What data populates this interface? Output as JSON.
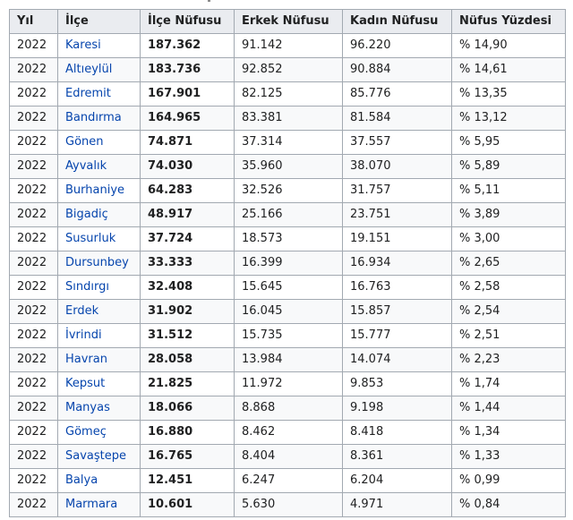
{
  "table": {
    "headers": [
      "Yıl",
      "İlçe",
      "İlçe Nüfusu",
      "Erkek Nüfusu",
      "Kadın Nüfusu",
      "Nüfus Yüzdesi"
    ],
    "rows": [
      {
        "year": "2022",
        "district": "Karesi",
        "population": "187.362",
        "male": "91.142",
        "female": "96.220",
        "share": "% 14,90"
      },
      {
        "year": "2022",
        "district": "Altıeylül",
        "population": "183.736",
        "male": "92.852",
        "female": "90.884",
        "share": "% 14,61"
      },
      {
        "year": "2022",
        "district": "Edremit",
        "population": "167.901",
        "male": "82.125",
        "female": "85.776",
        "share": "% 13,35"
      },
      {
        "year": "2022",
        "district": "Bandırma",
        "population": "164.965",
        "male": "83.381",
        "female": "81.584",
        "share": "% 13,12"
      },
      {
        "year": "2022",
        "district": "Gönen",
        "population": "74.871",
        "male": "37.314",
        "female": "37.557",
        "share": "% 5,95"
      },
      {
        "year": "2022",
        "district": "Ayvalık",
        "population": "74.030",
        "male": "35.960",
        "female": "38.070",
        "share": "% 5,89"
      },
      {
        "year": "2022",
        "district": "Burhaniye",
        "population": "64.283",
        "male": "32.526",
        "female": "31.757",
        "share": "% 5,11"
      },
      {
        "year": "2022",
        "district": "Bigadiç",
        "population": "48.917",
        "male": "25.166",
        "female": "23.751",
        "share": "% 3,89"
      },
      {
        "year": "2022",
        "district": "Susurluk",
        "population": "37.724",
        "male": "18.573",
        "female": "19.151",
        "share": "% 3,00"
      },
      {
        "year": "2022",
        "district": "Dursunbey",
        "population": "33.333",
        "male": "16.399",
        "female": "16.934",
        "share": "% 2,65"
      },
      {
        "year": "2022",
        "district": "Sındırgı",
        "population": "32.408",
        "male": "15.645",
        "female": "16.763",
        "share": "% 2,58"
      },
      {
        "year": "2022",
        "district": "Erdek",
        "population": "31.902",
        "male": "16.045",
        "female": "15.857",
        "share": "% 2,54"
      },
      {
        "year": "2022",
        "district": "İvrindi",
        "population": "31.512",
        "male": "15.735",
        "female": "15.777",
        "share": "% 2,51"
      },
      {
        "year": "2022",
        "district": "Havran",
        "population": "28.058",
        "male": "13.984",
        "female": "14.074",
        "share": "% 2,23"
      },
      {
        "year": "2022",
        "district": "Kepsut",
        "population": "21.825",
        "male": "11.972",
        "female": "9.853",
        "share": "% 1,74"
      },
      {
        "year": "2022",
        "district": "Manyas",
        "population": "18.066",
        "male": "8.868",
        "female": "9.198",
        "share": "% 1,44"
      },
      {
        "year": "2022",
        "district": "Gömeç",
        "population": "16.880",
        "male": "8.462",
        "female": "8.418",
        "share": "% 1,34"
      },
      {
        "year": "2022",
        "district": "Savaştepe",
        "population": "16.765",
        "male": "8.404",
        "female": "8.361",
        "share": "% 1,33"
      },
      {
        "year": "2022",
        "district": "Balya",
        "population": "12.451",
        "male": "6.247",
        "female": "6.204",
        "share": "% 0,99"
      },
      {
        "year": "2022",
        "district": "Marmara",
        "population": "10.601",
        "male": "5.630",
        "female": "4.971",
        "share": "% 0,84"
      }
    ]
  },
  "colors": {
    "link": "#0645ad",
    "border": "#a2a9b1",
    "header_bg": "#eaecf0",
    "row_alt_bg": "#f8f9fa",
    "text": "#202122"
  }
}
